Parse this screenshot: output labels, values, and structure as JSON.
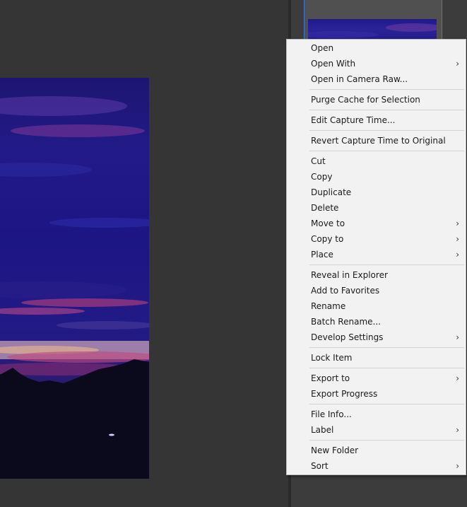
{
  "menu": {
    "groups": [
      [
        {
          "label": "Open",
          "submenu": false
        },
        {
          "label": "Open With",
          "submenu": true
        },
        {
          "label": "Open in Camera Raw...",
          "submenu": false
        }
      ],
      [
        {
          "label": "Purge Cache for Selection",
          "submenu": false
        }
      ],
      [
        {
          "label": "Edit Capture Time...",
          "submenu": false
        }
      ],
      [
        {
          "label": "Revert Capture Time to Original",
          "submenu": false
        }
      ],
      [
        {
          "label": "Cut",
          "submenu": false
        },
        {
          "label": "Copy",
          "submenu": false
        },
        {
          "label": "Duplicate",
          "submenu": false
        },
        {
          "label": "Delete",
          "submenu": false
        },
        {
          "label": "Move to",
          "submenu": true
        },
        {
          "label": "Copy to",
          "submenu": true
        },
        {
          "label": "Place",
          "submenu": true
        }
      ],
      [
        {
          "label": "Reveal in Explorer",
          "submenu": false
        },
        {
          "label": "Add to Favorites",
          "submenu": false
        },
        {
          "label": "Rename",
          "submenu": false
        },
        {
          "label": "Batch Rename...",
          "submenu": false
        },
        {
          "label": "Develop Settings",
          "submenu": true
        }
      ],
      [
        {
          "label": "Lock Item",
          "submenu": false
        }
      ],
      [
        {
          "label": "Export to",
          "submenu": true
        },
        {
          "label": "Export Progress",
          "submenu": false
        }
      ],
      [
        {
          "label": "File Info...",
          "submenu": false
        },
        {
          "label": "Label",
          "submenu": true
        }
      ],
      [
        {
          "label": "New Folder",
          "submenu": false
        },
        {
          "label": "Sort",
          "submenu": true
        }
      ]
    ],
    "submenu_glyph": "›"
  },
  "colors": {
    "menu_bg": "#f2f2f2",
    "selection_border": "#3a7bd5",
    "app_bg": "#353535"
  }
}
